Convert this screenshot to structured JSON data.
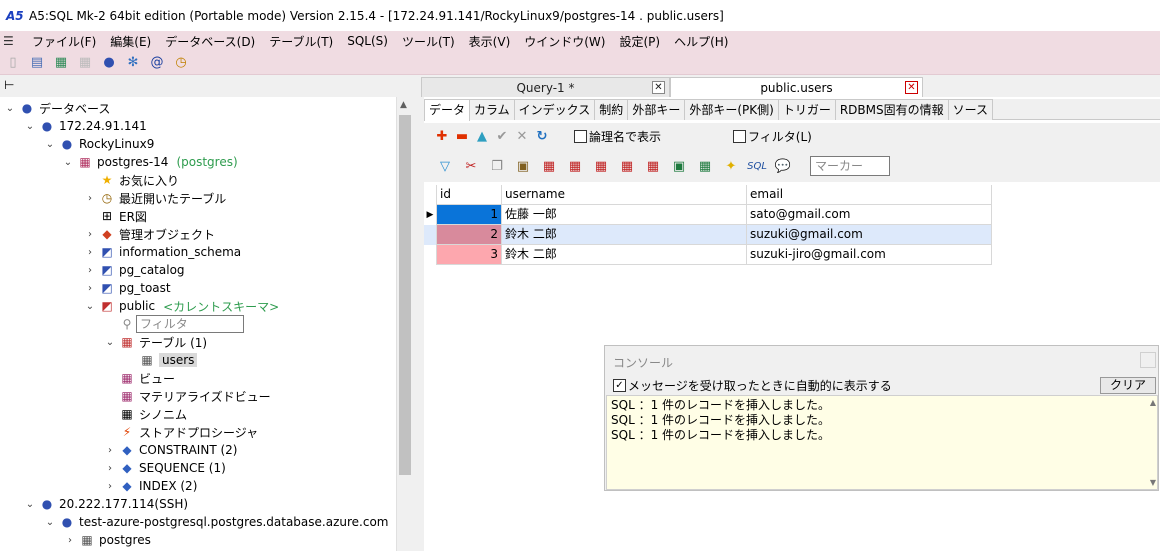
{
  "window": {
    "title": "A5:SQL Mk-2 64bit edition (Portable mode) Version 2.15.4 - [172.24.91.141/RockyLinux9/postgres-14 . public.users]",
    "app_icon": "a5-logo-icon"
  },
  "menu": [
    "ファイル(F)",
    "編集(E)",
    "データベース(D)",
    "テーブル(T)",
    "SQL(S)",
    "ツール(T)",
    "表示(V)",
    "ウインドウ(W)",
    "設定(P)",
    "ヘルプ(H)"
  ],
  "tree": {
    "root": "データベース",
    "host1": "172.24.91.141",
    "rocky": "RockyLinux9",
    "db": "postgres-14",
    "db_note": "(postgres)",
    "favorites": "お気に入り",
    "recent": "最近開いたテーブル",
    "er": "ER図",
    "admin": "管理オブジェクト",
    "info_schema": "information_schema",
    "pg_catalog": "pg_catalog",
    "pg_toast": "pg_toast",
    "public": "public",
    "public_note": "<カレントスキーマ>",
    "filter_placeholder": "フィルタ",
    "tables": "テーブル (1)",
    "users": "users",
    "view": "ビュー",
    "mview": "マテリアライズドビュー",
    "synonym": "シノニム",
    "proc": "ストアドプロシージャ",
    "constraint": "CONSTRAINT (2)",
    "sequence": "SEQUENCE (1)",
    "index": "INDEX (2)",
    "host2": "20.222.177.114(SSH)",
    "azure": "test-azure-postgresql.postgres.database.azure.com",
    "azure_db": "postgres"
  },
  "doc_tabs": [
    "Query-1 *",
    "public.users"
  ],
  "sub_tabs": [
    "データ",
    "カラム",
    "インデックス",
    "制約",
    "外部キー",
    "外部キー(PK側)",
    "トリガー",
    "RDBMS固有の情報",
    "ソース"
  ],
  "grid_toolbar": {
    "logical_name": "論理名で表示",
    "filter": "フィルタ(L)",
    "marker_placeholder": "マーカー",
    "sql_label": "SQL"
  },
  "grid": {
    "columns": [
      "id",
      "username",
      "email"
    ],
    "rows": [
      {
        "id": "1",
        "username": "佐藤 一郎",
        "email": "sato@gmail.com"
      },
      {
        "id": "2",
        "username": "鈴木 二郎",
        "email": "suzuki@gmail.com"
      },
      {
        "id": "3",
        "username": "鈴木 二郎",
        "email": "suzuki-jiro@gmail.com"
      }
    ]
  },
  "console": {
    "title": "コンソール",
    "auto_show": "メッセージを受け取ったときに自動的に表示する",
    "clear": "クリア",
    "lines": [
      "SQL ：1 件のレコードを挿入しました。",
      "SQL ：1 件のレコードを挿入しました。",
      "SQL ：1 件のレコードを挿入しました。"
    ]
  }
}
